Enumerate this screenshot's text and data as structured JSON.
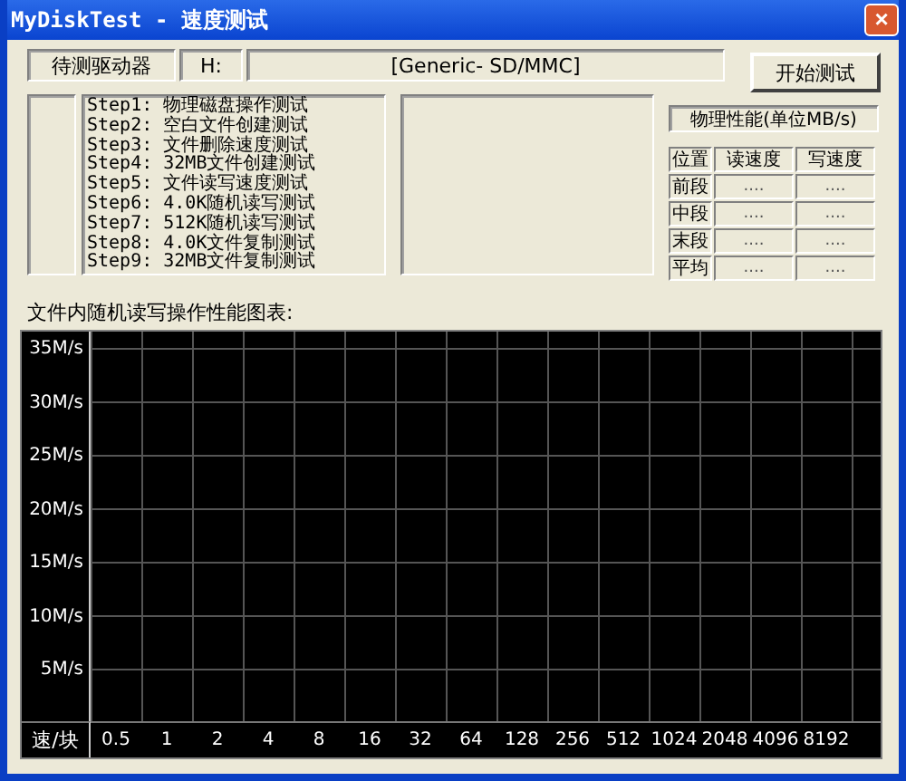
{
  "window": {
    "title": "MyDiskTest - 速度测试",
    "close": "×"
  },
  "drive": {
    "label": "待测驱动器",
    "letter": "H:",
    "name": "[Generic- SD/MMC]"
  },
  "start_button": "开始测试",
  "steps": [
    "Step1: 物理磁盘操作测试",
    "Step2: 空白文件创建测试",
    "Step3: 文件删除速度测试",
    "Step4: 32MB文件创建测试",
    "Step5: 文件读写速度测试",
    "Step6: 4.0K随机读写测试",
    "Step7: 512K随机读写测试",
    "Step8: 4.0K文件复制测试",
    "Step9: 32MB文件复制测试"
  ],
  "performance": {
    "title": "物理性能(单位MB/s)",
    "columns": [
      "位置",
      "读速度",
      "写速度"
    ],
    "rows": [
      {
        "position": "前段",
        "read": "....",
        "write": "...."
      },
      {
        "position": "中段",
        "read": "....",
        "write": "...."
      },
      {
        "position": "末段",
        "read": "....",
        "write": "...."
      },
      {
        "position": "平均",
        "read": "....",
        "write": "...."
      }
    ]
  },
  "chart": {
    "title": "文件内随机读写操作性能图表:",
    "y_labels": [
      "35M/s",
      "30M/s",
      "25M/s",
      "20M/s",
      "15M/s",
      "10M/s",
      "5M/s"
    ],
    "corner_label": "速/块",
    "x_labels": [
      "0.5",
      "1",
      "2",
      "4",
      "8",
      "16",
      "32",
      "64",
      "128",
      "256",
      "512",
      "1024",
      "2048",
      "4096",
      "8192"
    ]
  }
}
